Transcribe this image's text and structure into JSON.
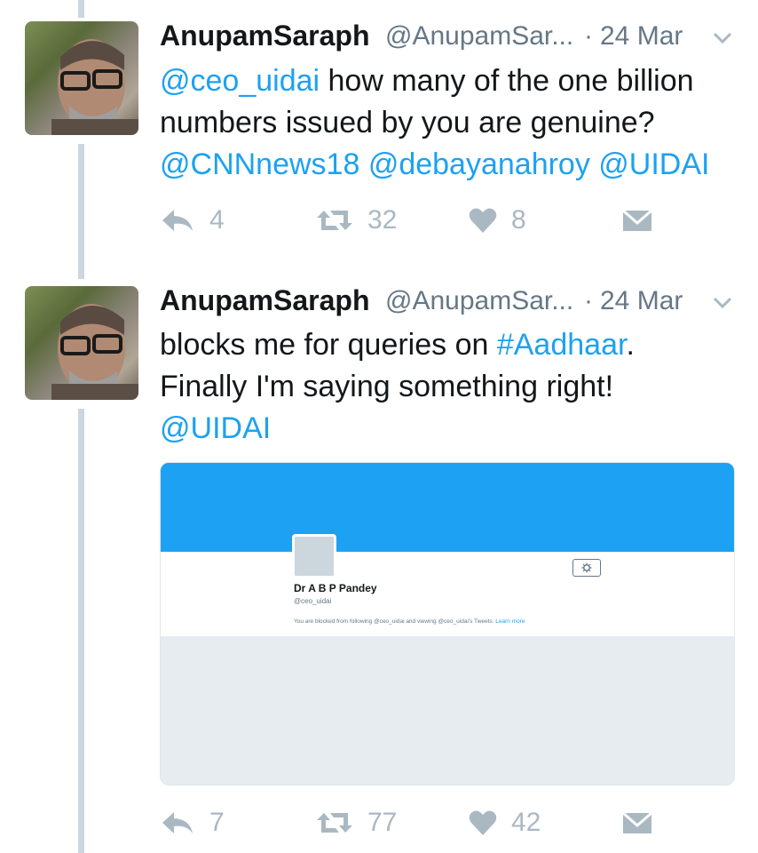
{
  "tweets": [
    {
      "name": "AnupamSaraph",
      "handle": "@AnupamSar...",
      "dot": "·",
      "date": "24 Mar",
      "text_lines": [
        [
          {
            "t": "@ceo_uidai",
            "link": true
          },
          {
            "t": " how many of the one billion",
            "link": false
          }
        ],
        [
          {
            "t": "numbers issued by you are genuine?",
            "link": false
          }
        ],
        [
          {
            "t": "@CNNnews18 @debayanahroy @UIDAI",
            "link": true
          }
        ]
      ],
      "reply_count": "4",
      "retweet_count": "32",
      "like_count": "8"
    },
    {
      "name": "AnupamSaraph",
      "handle": "@AnupamSar...",
      "dot": "·",
      "date": "24 Mar",
      "text_lines": [
        [
          {
            "t": "blocks me for queries on ",
            "link": false
          },
          {
            "t": "#Aadhaar",
            "link": true
          },
          {
            "t": ".",
            "link": false
          }
        ],
        [
          {
            "t": "Finally I'm saying something right!",
            "link": false
          }
        ],
        [
          {
            "t": "@UIDAI",
            "link": true
          }
        ]
      ],
      "reply_count": "7",
      "retweet_count": "77",
      "like_count": "42"
    }
  ],
  "embedded_card": {
    "profile_name": "Dr A B P Pandey",
    "profile_handle": "@ceo_uidai",
    "blocked_note": "You are blocked from following @ceo_uidai and viewing @ceo_uidai's Tweets.",
    "learn_more": "Learn more"
  },
  "colors": {
    "link": "#1da1f2",
    "action_gray": "#aab8c2",
    "banner": "#1da1f2"
  },
  "icons": [
    "reply-icon",
    "retweet-icon",
    "like-icon",
    "direct-message-icon",
    "chevron-down-icon",
    "gear-icon"
  ]
}
